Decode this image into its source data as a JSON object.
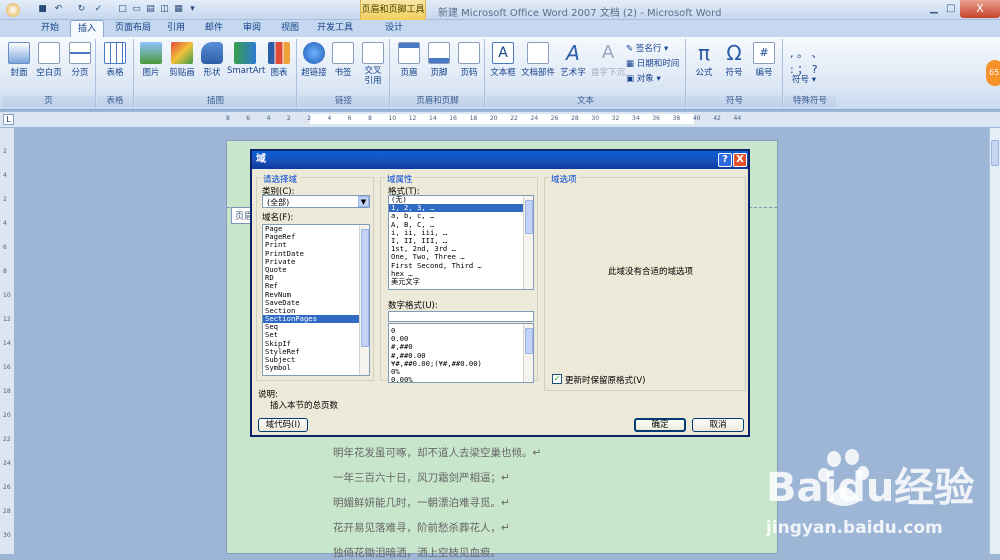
{
  "titlebar": {
    "context_tab": "页眉和页脚工具",
    "title": "新建 Microsoft Office Word 2007 文档 (2) - Microsoft Word",
    "close_glyph": "X"
  },
  "tabs": [
    "开始",
    "插入",
    "页面布局",
    "引用",
    "邮件",
    "审阅",
    "视图",
    "开发工具",
    "设计"
  ],
  "ribbon": {
    "groups": [
      {
        "label": "页",
        "buttons": [
          "封面",
          "空白页",
          "分页"
        ]
      },
      {
        "label": "表格",
        "buttons": [
          "表格"
        ]
      },
      {
        "label": "插图",
        "buttons": [
          "图片",
          "剪贴画",
          "形状",
          "SmartArt",
          "图表"
        ]
      },
      {
        "label": "链接",
        "buttons": [
          "超链接",
          "书签",
          "交叉引用"
        ]
      },
      {
        "label": "页眉和页脚",
        "buttons": [
          "页眉",
          "页脚",
          "页码"
        ]
      },
      {
        "label": "文本",
        "buttons": [
          "文本框",
          "文档部件",
          "艺术字",
          "首字下沉"
        ],
        "small_buttons": [
          "签名行",
          "日期和时间",
          "对象"
        ]
      },
      {
        "label": "符号",
        "buttons": [
          "公式",
          "符号",
          "编号"
        ]
      },
      {
        "label": "特殊符号",
        "buttons": [
          "符号"
        ]
      }
    ],
    "avatar_text": "65"
  },
  "ruler": {
    "ticks": [
      "8",
      "6",
      "4",
      "2",
      "2",
      "4",
      "6",
      "8",
      "10",
      "12",
      "14",
      "16",
      "18",
      "20",
      "22",
      "24",
      "26",
      "28",
      "30",
      "32",
      "34",
      "36",
      "38",
      "40",
      "42",
      "44"
    ],
    "vticks": [
      "2",
      "4",
      "2",
      "4",
      "6",
      "8",
      "10",
      "12",
      "14",
      "16",
      "18",
      "20",
      "22",
      "24",
      "26",
      "28",
      "30"
    ]
  },
  "document": {
    "header_label": "页眉",
    "lines": [
      "明年花发虽可啄，却不道人去梁空巢也倾。↵",
      "一年三百六十日，风刀霜剑严相逼；↵",
      "明媚鲜妍能几时，一朝漂泊难寻觅。↵",
      "花开易见落难寻，阶前愁杀葬花人，↵",
      "独倚花锄泪暗洒，洒上空枝见血痕。"
    ]
  },
  "dialog": {
    "title": "域",
    "help_glyph": "?",
    "close_glyph": "X",
    "choose_field_title": "请选择域",
    "category_label": "类别(C):",
    "category_value": "(全部)",
    "field_names_label": "域名(F):",
    "field_names": [
      "Page",
      "PageRef",
      "Print",
      "PrintDate",
      "Private",
      "Quote",
      "RD",
      "Ref",
      "RevNum",
      "SaveDate",
      "Section",
      "SectionPages",
      "Seq",
      "Set",
      "SkipIf",
      "StyleRef",
      "Subject",
      "Symbol"
    ],
    "field_names_selected": 11,
    "field_props_title": "域属性",
    "format_label": "格式(T):",
    "formats": [
      "(无)",
      "1, 2, 3, …",
      "a, b, c, …",
      "A, B, C, …",
      "i, ii, iii, …",
      "I, II, III, …",
      "1st, 2nd, 3rd …",
      "One, Two, Three …",
      "First Second, Third …",
      "hex …",
      "美元文字"
    ],
    "formats_selected": 1,
    "number_format_label": "数字格式(U):",
    "number_format_value": "",
    "number_formats": [
      "0",
      "0.00",
      "#,##0",
      "#,##0.00",
      "¥#,##0.00;(¥#,##0.00)",
      "0%",
      "0.00%"
    ],
    "field_options_title": "域选项",
    "no_options_text": "此域没有合适的域选项",
    "preserve_format_label": "更新时保留原格式(V)",
    "preserve_format_checked": true,
    "description_label": "说明:",
    "description_text": "插入本节的总页数",
    "field_codes_button": "域代码(I)",
    "ok_button": "确定",
    "cancel_button": "取消"
  },
  "watermark": {
    "brand": "Baidu经验",
    "url": "jingyan.baidu.com"
  }
}
